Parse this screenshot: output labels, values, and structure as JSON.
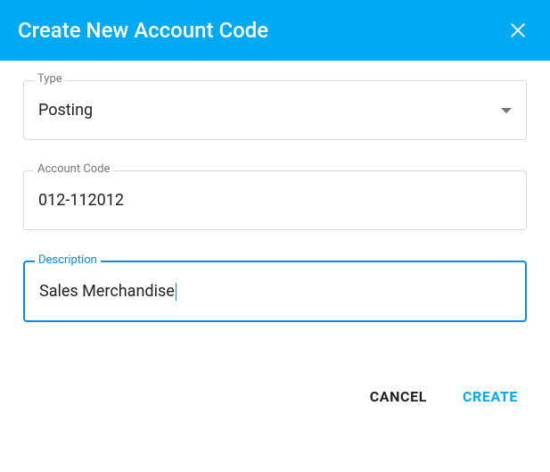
{
  "dialog": {
    "title": "Create New Account Code"
  },
  "fields": {
    "type": {
      "label": "Type",
      "value": "Posting"
    },
    "account_code": {
      "label": "Account Code",
      "value": "012-112012"
    },
    "description": {
      "label": "Description",
      "value": "Sales Merchandise"
    }
  },
  "actions": {
    "cancel": "Cancel",
    "create": "Create"
  }
}
